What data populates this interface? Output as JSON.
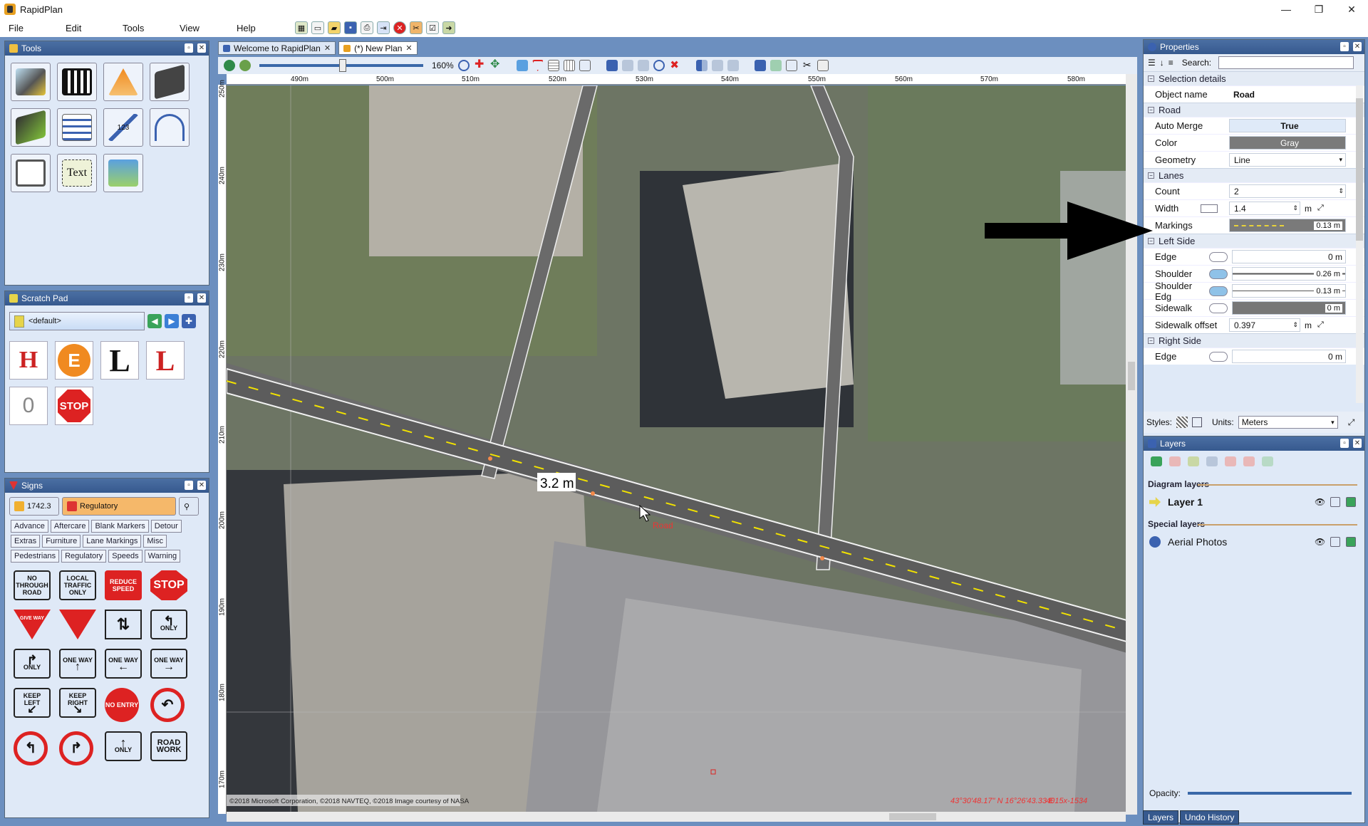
{
  "window": {
    "title": "RapidPlan",
    "min_icon": "minimize-icon",
    "max_icon": "maximize-icon",
    "close_icon": "close-icon"
  },
  "menu": [
    "File",
    "Edit",
    "Tools",
    "View",
    "Help"
  ],
  "panels": {
    "tools": {
      "title": "Tools"
    },
    "scratchpad": {
      "title": "Scratch Pad",
      "selected": "<default>",
      "items": [
        "H",
        "E",
        "L",
        "L",
        "0",
        "STOP"
      ]
    },
    "signs": {
      "title": "Signs",
      "code": "1742.3",
      "category_selected": "Regulatory",
      "categories_row1": [
        "Advance",
        "Aftercare",
        "Blank Markers",
        "Detour"
      ],
      "categories_row2": [
        "Extras",
        "Furniture",
        "Lane Markings",
        "Misc"
      ],
      "categories_row3": [
        "Pedestrians",
        "Regulatory",
        "Speeds",
        "Warning"
      ],
      "signs": [
        "NO THROUGH ROAD",
        "LOCAL TRAFFIC ONLY",
        "REDUCE SPEED",
        "STOP",
        "GIVE WAY",
        "",
        "",
        "ONLY",
        "ONLY",
        "ONE WAY",
        "ONE WAY",
        "ONE WAY",
        "KEEP LEFT",
        "KEEP RIGHT",
        "NO ENTRY",
        "",
        "",
        "",
        "ONLY",
        "ROAD WORK"
      ]
    }
  },
  "doc": {
    "tabs": [
      {
        "label": "Welcome to RapidPlan"
      },
      {
        "label": "(*) New Plan"
      }
    ],
    "zoom": "160%",
    "ruler_h": [
      "490m",
      "500m",
      "510m",
      "520m",
      "530m",
      "540m",
      "550m",
      "560m",
      "570m",
      "580m"
    ],
    "ruler_v": [
      "250m",
      "240m",
      "230m",
      "220m",
      "210m",
      "200m",
      "190m",
      "180m",
      "170m"
    ],
    "measure": "3.2 m",
    "road_label": "Road",
    "copyright": "©2018 Microsoft Corporation, ©2018 NAVTEQ, ©2018 Image courtesy of NASA",
    "coords": "43°30'48.17\" N 16°26'43.33 E",
    "dims": "4015x-1534"
  },
  "properties": {
    "title": "Properties",
    "search_label": "Search:",
    "sections": {
      "selection": "Selection details",
      "road": "Road",
      "lanes": "Lanes",
      "left": "Left Side",
      "right": "Right Side"
    },
    "rows": {
      "object_name": {
        "k": "Object name",
        "v": "Road"
      },
      "auto_merge": {
        "k": "Auto Merge",
        "v": "True"
      },
      "color": {
        "k": "Color",
        "v": "Gray"
      },
      "geometry": {
        "k": "Geometry",
        "v": "Line"
      },
      "count": {
        "k": "Count",
        "v": "2"
      },
      "width": {
        "k": "Width",
        "v": "1.4",
        "unit": "m"
      },
      "markings": {
        "k": "Markings",
        "v": "0.13 m"
      },
      "edge": {
        "k": "Edge",
        "v": "0 m"
      },
      "shoulder": {
        "k": "Shoulder",
        "v": "0.26 m"
      },
      "shoulder_edge": {
        "k": "Shoulder Edg",
        "v": "0.13 m"
      },
      "sidewalk": {
        "k": "Sidewalk",
        "v": "0 m"
      },
      "sidewalk_offset": {
        "k": "Sidewalk offset",
        "v": "0.397",
        "unit": "m"
      },
      "r_edge": {
        "k": "Edge",
        "v": "0 m"
      }
    },
    "styles_label": "Styles:",
    "units_label": "Units:",
    "units_value": "Meters"
  },
  "layers": {
    "title": "Layers",
    "diagram_layers": "Diagram layers",
    "layer1": "Layer 1",
    "special_layers": "Special layers",
    "aerial": "Aerial Photos",
    "opacity_label": "Opacity:"
  },
  "bottom_tabs": [
    "Layers",
    "Undo History"
  ],
  "colors": {
    "accent": "#36598e",
    "frame": "#6c8fbf",
    "road": "#5c5c5c",
    "lane_marking": "#f2e200"
  }
}
